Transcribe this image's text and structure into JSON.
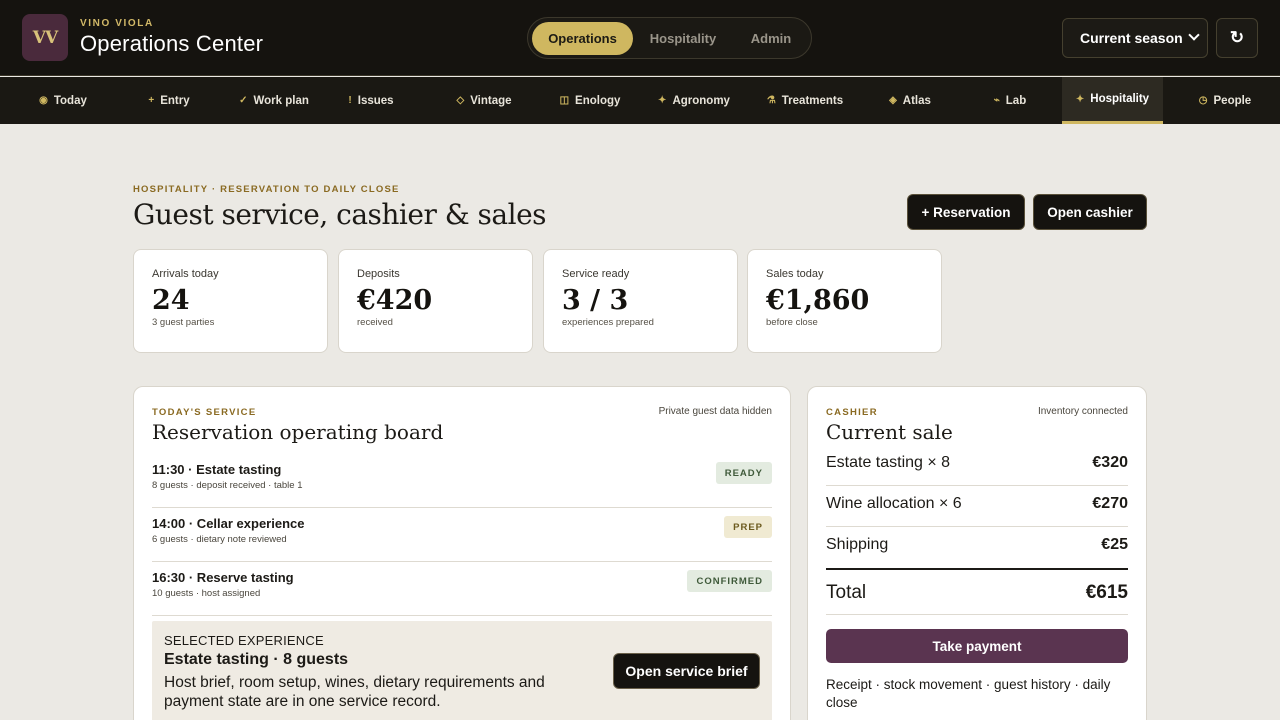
{
  "brand": {
    "logo": "VV",
    "eyebrow": "VINO VIOLA",
    "title": "Operations Center"
  },
  "modes": [
    {
      "label": "Operations",
      "active": true
    },
    {
      "label": "Hospitality",
      "active": false
    },
    {
      "label": "Admin",
      "active": false
    }
  ],
  "season": {
    "label": "Current season",
    "options": [
      "Current season"
    ]
  },
  "refresh": {
    "glyph": "↻"
  },
  "nav": [
    {
      "icon": "◉",
      "label": "Today"
    },
    {
      "icon": "+",
      "label": "Entry"
    },
    {
      "icon": "✓",
      "label": "Work plan"
    },
    {
      "icon": "!",
      "label": "Issues"
    },
    {
      "icon": "◇",
      "label": "Vintage"
    },
    {
      "icon": "◫",
      "label": "Enology"
    },
    {
      "icon": "✦",
      "label": "Agronomy"
    },
    {
      "icon": "⚗",
      "label": "Treatments"
    },
    {
      "icon": "◈",
      "label": "Atlas"
    },
    {
      "icon": "⌁",
      "label": "Lab"
    },
    {
      "icon": "✦",
      "label": "Hospitality",
      "active": true
    },
    {
      "icon": "◷",
      "label": "People"
    }
  ],
  "header": {
    "eyebrow": "HOSPITALITY · RESERVATION TO DAILY CLOSE",
    "title": "Guest service, cashier & sales",
    "reservation_btn": "+ Reservation",
    "cashier_btn": "Open cashier"
  },
  "kpis": [
    {
      "label": "Arrivals today",
      "value": "24",
      "sub": "3 guest parties"
    },
    {
      "label": "Deposits",
      "value": "€420",
      "sub": "received"
    },
    {
      "label": "Service ready",
      "value": "3 / 3",
      "sub": "experiences prepared"
    },
    {
      "label": "Sales today",
      "value": "€1,860",
      "sub": "before close"
    }
  ],
  "service": {
    "eyebrow": "TODAY'S SERVICE",
    "note": "Private guest data hidden",
    "title": "Reservation operating board",
    "rows": [
      {
        "title": "11:30 · Estate tasting",
        "meta": "8 guests · deposit received · table 1",
        "status": "READY"
      },
      {
        "title": "14:00 · Cellar experience",
        "meta": "6 guests · dietary note reviewed",
        "status": "PREP"
      },
      {
        "title": "16:30 · Reserve tasting",
        "meta": "10 guests · host assigned",
        "status": "CONFIRMED"
      }
    ],
    "selected": {
      "eyebrow": "SELECTED EXPERIENCE",
      "title": "Estate tasting · 8 guests",
      "desc": "Host brief, room setup, wines, dietary requirements and payment state are in one service record.",
      "button": "Open service brief"
    }
  },
  "cashier": {
    "eyebrow": "CASHIER",
    "note": "Inventory connected",
    "title": "Current sale",
    "items": [
      {
        "label": "Estate tasting × 8",
        "amount": "€320"
      },
      {
        "label": "Wine allocation × 6",
        "amount": "€270"
      },
      {
        "label": "Shipping",
        "amount": "€25"
      }
    ],
    "total_label": "Total",
    "total_amount": "€615",
    "pay_btn": "Take payment",
    "footer": "Receipt · stock movement · guest history · daily close"
  }
}
